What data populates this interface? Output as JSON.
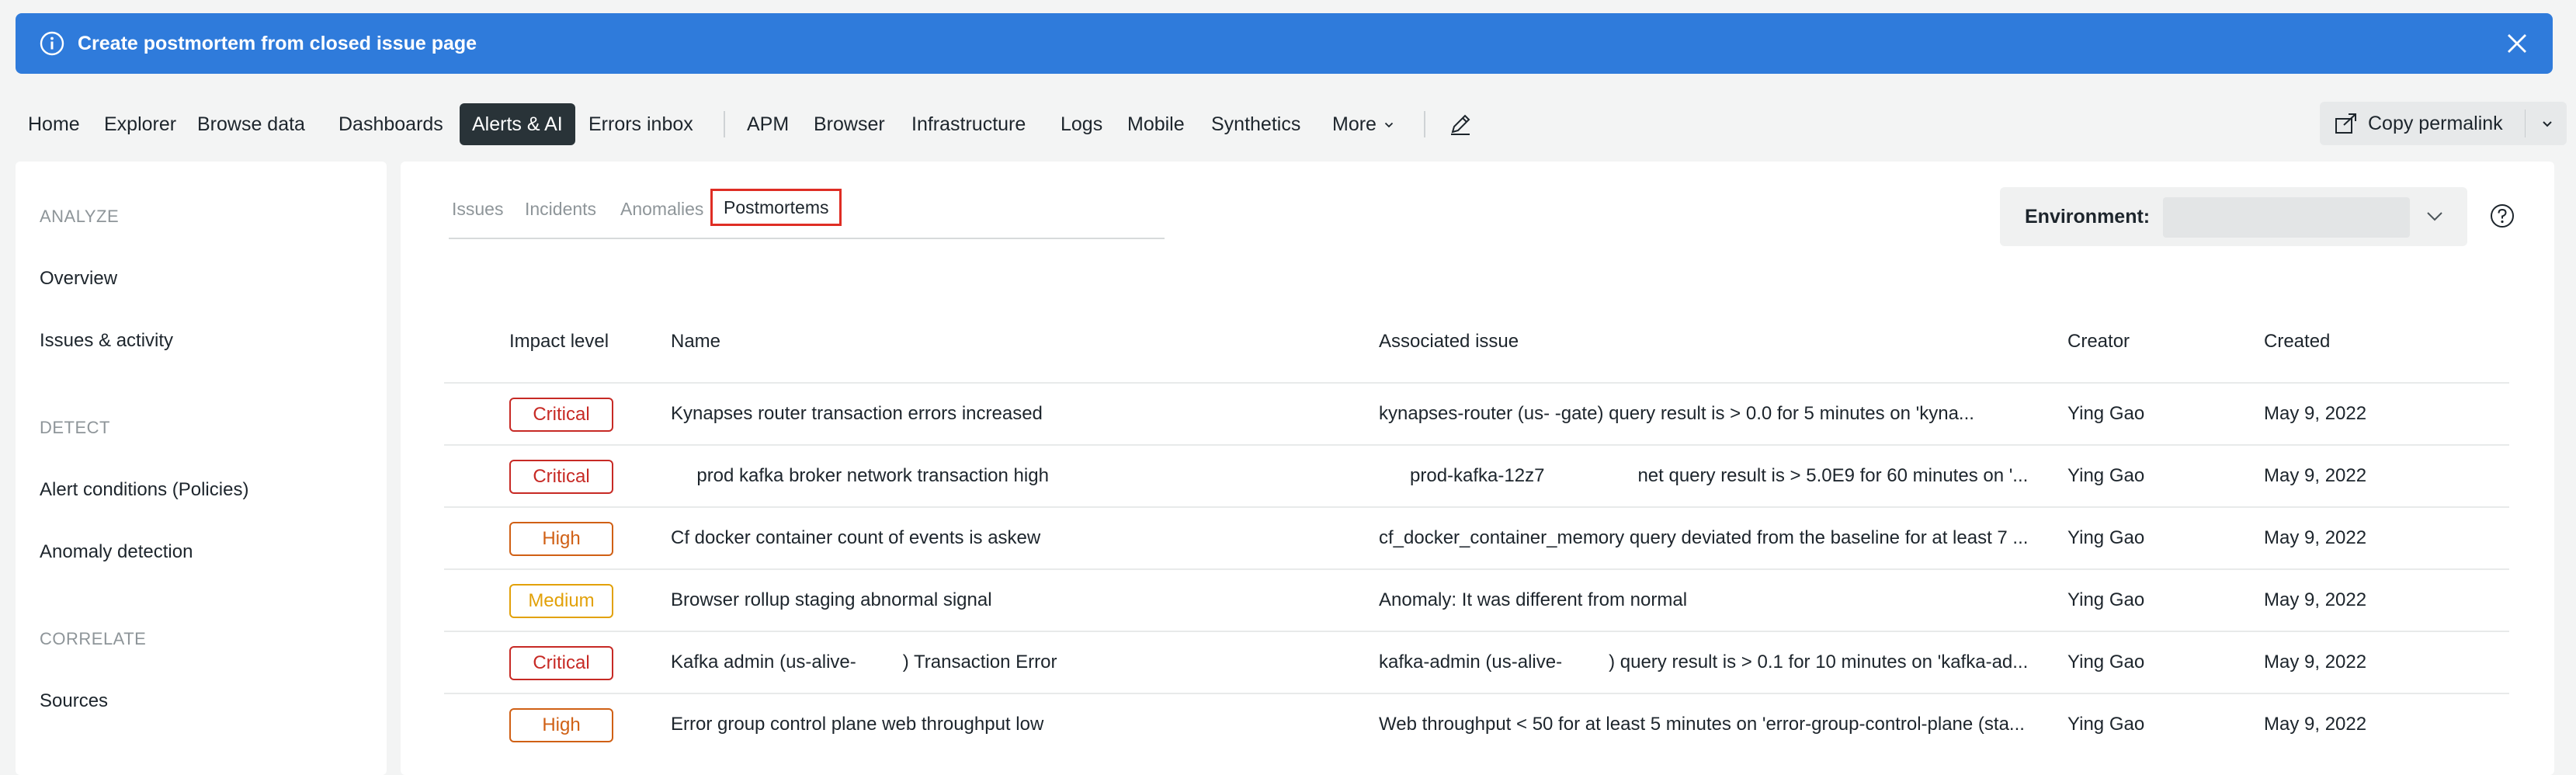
{
  "banner": {
    "title": "Create postmortem from closed issue page"
  },
  "nav": {
    "items": [
      "Home",
      "Explorer",
      "Browse data",
      "Dashboards",
      "Alerts & AI",
      "Errors inbox",
      "APM",
      "Browser",
      "Infrastructure",
      "Logs",
      "Mobile",
      "Synthetics",
      "More"
    ],
    "active": "Alerts & AI",
    "copy_permalink": "Copy permalink"
  },
  "sidebar": {
    "sections": [
      {
        "heading": "ANALYZE",
        "items": [
          "Overview",
          "Issues & activity"
        ]
      },
      {
        "heading": "DETECT",
        "items": [
          "Alert conditions (Policies)",
          "Anomaly detection"
        ]
      },
      {
        "heading": "CORRELATE",
        "items": [
          "Sources"
        ]
      }
    ]
  },
  "tabs": [
    "Issues",
    "Incidents",
    "Anomalies",
    "Postmortems"
  ],
  "active_tab": "Postmortems",
  "environment": {
    "label": "Environment:",
    "value": ""
  },
  "table": {
    "columns": [
      "Impact level",
      "Name",
      "Associated issue",
      "Creator",
      "Created"
    ],
    "rows": [
      {
        "impact": "Critical",
        "name": "Kynapses router transaction errors increased",
        "issue": "kynapses-router (us-         -gate) query result is > 0.0 for 5 minutes on 'kyna...",
        "creator": "Ying Gao",
        "created": "May 9, 2022"
      },
      {
        "impact": "Critical",
        "name": "     prod kafka broker network transaction high",
        "issue": "      prod-kafka-12z7                  net query result is > 5.0E9 for 60 minutes on '...",
        "creator": "Ying Gao",
        "created": "May 9, 2022"
      },
      {
        "impact": "High",
        "name": "Cf docker container count of events is askew",
        "issue": "cf_docker_container_memory query deviated from the baseline for at least 7 ...",
        "creator": "Ying Gao",
        "created": "May 9, 2022"
      },
      {
        "impact": "Medium",
        "name": "Browser rollup staging abnormal signal",
        "issue": "Anomaly: It was different from normal",
        "creator": "Ying Gao",
        "created": "May 9, 2022"
      },
      {
        "impact": "Critical",
        "name": "Kafka admin (us-alive-         ) Transaction Error",
        "issue": "kafka-admin (us-alive-         ) query result is > 0.1 for 10 minutes on 'kafka-ad...",
        "creator": "Ying Gao",
        "created": "May 9, 2022"
      },
      {
        "impact": "High",
        "name": "Error group control plane web throughput low",
        "issue": "Web throughput < 50 for at least 5 minutes on 'error-group-control-plane (sta...",
        "creator": "Ying Gao",
        "created": "May 9, 2022"
      }
    ]
  },
  "colors": {
    "banner": "#2f7bdb",
    "nav_active": "#293338",
    "critical": "#c72a25",
    "high": "#d06015",
    "medium": "#e2a109",
    "tab_highlight": "#df2d24"
  },
  "icons": {
    "banner": "info-icon",
    "close": "close-icon",
    "edit": "pencil-icon",
    "permalink": "share-link-icon",
    "help": "help-icon"
  }
}
